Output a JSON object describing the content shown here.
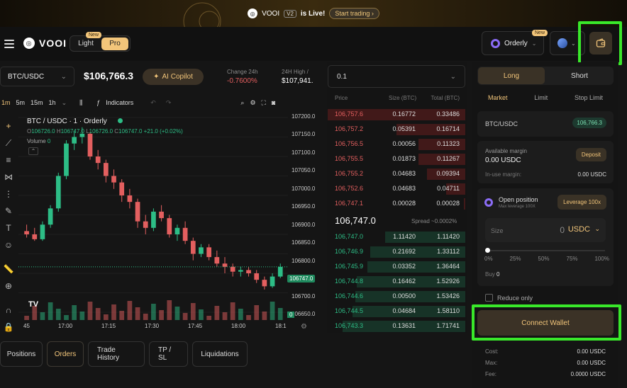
{
  "banner": {
    "brand": "VOOI",
    "version": "V2",
    "live": "is Live!",
    "cta": "Start trading ›"
  },
  "header": {
    "brand": "VOOI",
    "mode_light": "Light",
    "mode_pro": "Pro",
    "new_badge": "New",
    "network": "Orderly",
    "network_new": "New"
  },
  "ticker": {
    "pair": "BTC/USDC",
    "price": "$106,766.3",
    "ai_copilot": "AI Copilot",
    "change_label": "Change 24h",
    "change_value": "-0.7600%",
    "high_label": "24H High /",
    "high_value": "$107,941."
  },
  "toolbar": {
    "intervals": [
      "1m",
      "5m",
      "15m",
      "1h"
    ],
    "indicators": "Indicators"
  },
  "chart": {
    "title": "BTC / USDC · 1 · Orderly",
    "ohlc": {
      "o": "106726.0",
      "h": "106747.0",
      "l": "106726.0",
      "c": "106747.0",
      "chg": "+21.0 (+0.02%)"
    },
    "volume_label": "Volume",
    "volume_value": "0",
    "current_price_tag": "106747.0",
    "volume_tag": "0",
    "ylabels": [
      "107200.0",
      "107150.0",
      "107100.0",
      "107050.0",
      "107000.0",
      "106950.0",
      "106900.0",
      "106850.0",
      "106800.0",
      "106700.0",
      "106650.0"
    ],
    "xlabels": [
      "45",
      "17:00",
      "17:15",
      "17:30",
      "17:45",
      "18:00",
      "18:1"
    ]
  },
  "chart_data": {
    "type": "candlestick",
    "title": "BTC / USDC · 1 · Orderly",
    "ylim": [
      106620,
      107220
    ],
    "candles": [
      [
        106870,
        106890,
        106850,
        106860
      ],
      [
        106860,
        106880,
        106840,
        106845
      ],
      [
        106845,
        106900,
        106840,
        106890
      ],
      [
        106890,
        106950,
        106880,
        106940
      ],
      [
        106940,
        107050,
        106930,
        107040
      ],
      [
        107040,
        107150,
        107030,
        107140
      ],
      [
        107140,
        107180,
        107120,
        107160
      ],
      [
        107160,
        107190,
        107140,
        107170
      ],
      [
        107170,
        107175,
        107090,
        107100
      ],
      [
        107100,
        107120,
        107060,
        107080
      ],
      [
        107080,
        107090,
        107020,
        107040
      ],
      [
        107040,
        107060,
        107000,
        107020
      ],
      [
        107020,
        107030,
        106960,
        106980
      ],
      [
        106980,
        107000,
        106940,
        106960
      ],
      [
        106960,
        106970,
        106880,
        106900
      ],
      [
        106900,
        106920,
        106860,
        106880
      ],
      [
        106880,
        106940,
        106870,
        106930
      ],
      [
        106930,
        106950,
        106900,
        106910
      ],
      [
        106910,
        106920,
        106850,
        106860
      ],
      [
        106860,
        106890,
        106840,
        106880
      ],
      [
        106880,
        106900,
        106830,
        106840
      ],
      [
        106840,
        106850,
        106780,
        106800
      ],
      [
        106800,
        106830,
        106790,
        106820
      ],
      [
        106820,
        106830,
        106780,
        106790
      ],
      [
        106790,
        106810,
        106760,
        106770
      ],
      [
        106770,
        106790,
        106740,
        106760
      ],
      [
        106760,
        106770,
        106730,
        106745
      ],
      [
        106745,
        106760,
        106730,
        106750
      ],
      [
        106750,
        106760,
        106730,
        106740
      ],
      [
        106740,
        106750,
        106710,
        106720
      ],
      [
        106720,
        106730,
        106690,
        106700
      ],
      [
        106700,
        106740,
        106695,
        106730
      ],
      [
        106730,
        106770,
        106725,
        106760
      ]
    ]
  },
  "orderbook": {
    "depth": "0.1",
    "h_price": "Price",
    "h_size": "Size (BTC)",
    "h_total": "Total (BTC)",
    "asks": [
      {
        "p": "106,757.6",
        "s": "0.16772",
        "t": "0.33486",
        "d": 1.0
      },
      {
        "p": "106,757.2",
        "s": "0.05391",
        "t": "0.16714",
        "d": 0.5
      },
      {
        "p": "106,756.5",
        "s": "0.00056",
        "t": "0.11323",
        "d": 0.34
      },
      {
        "p": "106,755.5",
        "s": "0.01873",
        "t": "0.11267",
        "d": 0.34
      },
      {
        "p": "106,755.2",
        "s": "0.04683",
        "t": "0.09394",
        "d": 0.28
      },
      {
        "p": "106,752.6",
        "s": "0.04683",
        "t": "0.04711",
        "d": 0.14
      },
      {
        "p": "106,747.1",
        "s": "0.00028",
        "t": "0.00028",
        "d": 0.01
      }
    ],
    "mid": "106,747.0",
    "spread": "Spread ~0.0002%",
    "bids": [
      {
        "p": "106,747.0",
        "s": "1.11420",
        "t": "1.11420",
        "d": 0.58
      },
      {
        "p": "106,746.9",
        "s": "0.21692",
        "t": "1.33112",
        "d": 0.69
      },
      {
        "p": "106,745.9",
        "s": "0.03352",
        "t": "1.36464",
        "d": 0.71
      },
      {
        "p": "106,744.8",
        "s": "0.16462",
        "t": "1.52926",
        "d": 0.79
      },
      {
        "p": "106,744.6",
        "s": "0.00500",
        "t": "1.53426",
        "d": 0.8
      },
      {
        "p": "106,744.5",
        "s": "0.04684",
        "t": "1.58110",
        "d": 0.82
      },
      {
        "p": "106,743.3",
        "s": "0.13631",
        "t": "1.71741",
        "d": 0.89
      }
    ]
  },
  "bottom_tabs": [
    "Positions",
    "Orders",
    "Trade History",
    "TP / SL",
    "Liquidations"
  ],
  "order_panel": {
    "long": "Long",
    "short": "Short",
    "types": [
      "Market",
      "Limit",
      "Stop Limit"
    ],
    "pair": "BTC/USDC",
    "pair_price": "106,766.3",
    "available_label": "Available margin",
    "available_value": "0.00 USDC",
    "deposit": "Deposit",
    "inuse_label": "In-use margin:",
    "inuse_value": "0.00 USDC",
    "open_position": "Open position",
    "max_leverage": "Max leverage 100X",
    "leverage_btn": "Leverage 100x",
    "size_label": "Size",
    "size_value": "0",
    "size_unit": "USDC",
    "slider_labels": [
      "0%",
      "25%",
      "50%",
      "75%",
      "100%"
    ],
    "slider_fraction": 0,
    "buy_label": "Buy",
    "buy_value": "0",
    "reduce_only": "Reduce only",
    "connect_wallet": "Connect Wallet",
    "cost_label": "Cost:",
    "cost_value": "0.00 USDC",
    "max_label": "Max:",
    "max_value": "0.00 USDC",
    "fee_label": "Fee:",
    "fee_value": "0.0000 USDC"
  },
  "colors": {
    "accent": "#f2c57a",
    "up": "#2dbd86",
    "down": "#e35f5f",
    "highlight": "#39e82a"
  }
}
